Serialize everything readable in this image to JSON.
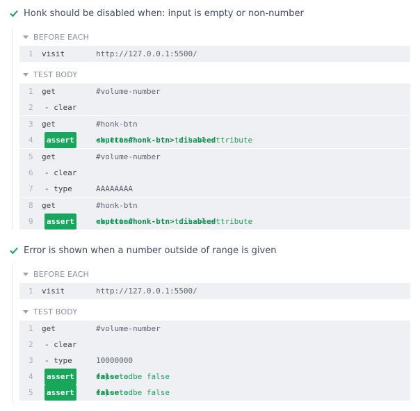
{
  "colors": {
    "pass": "#13a15a",
    "badge": "#16a75b",
    "row_bg": "#eff0f3"
  },
  "icons": {
    "check": "check-icon",
    "caret": "caret-down-icon"
  },
  "tests": [
    {
      "title": "Honk should be disabled when: input is empty or non-number",
      "before_each_label": "BEFORE EACH",
      "before_each": [
        {
          "num": "1",
          "name": "visit",
          "msg": "http://127.0.0.1:5500/"
        }
      ],
      "test_body_label": "TEST BODY",
      "body": [
        {
          "num": "1",
          "name": "get",
          "msg": "#volume-number"
        },
        {
          "num": "2",
          "name": "- clear",
          "msg": ""
        },
        {
          "num": "3",
          "name": "get",
          "msg": "#honk-btn"
        },
        {
          "num": "4",
          "name": "assert",
          "dash": "-",
          "pre": "expected ",
          "b1": "<button#honk-btn>",
          "mid": " to have attribute ",
          "b2": "disabled"
        },
        {
          "num": "5",
          "name": "get",
          "msg": "#volume-number"
        },
        {
          "num": "6",
          "name": "- clear",
          "msg": ""
        },
        {
          "num": "7",
          "name": "- type",
          "msg": "AAAAAAAA"
        },
        {
          "num": "8",
          "name": "get",
          "msg": "#honk-btn"
        },
        {
          "num": "9",
          "name": "assert",
          "dash": "-",
          "pre": "expected ",
          "b1": "<button#honk-btn>",
          "mid": " to have attribute ",
          "b2": "disabled"
        }
      ]
    },
    {
      "title": "Error is shown when a number outside of range is given",
      "before_each_label": "BEFORE EACH",
      "before_each": [
        {
          "num": "1",
          "name": "visit",
          "msg": "http://127.0.0.1:5500/"
        }
      ],
      "test_body_label": "TEST BODY",
      "body": [
        {
          "num": "1",
          "name": "get",
          "msg": "#volume-number"
        },
        {
          "num": "2",
          "name": "- clear",
          "msg": ""
        },
        {
          "num": "3",
          "name": "- type",
          "msg": "10000000"
        },
        {
          "num": "4",
          "name": "assert",
          "dash": "-",
          "pre": "expected ",
          "b1": "false",
          "mid": " to be false",
          "b2": ""
        },
        {
          "num": "5",
          "name": "assert",
          "dash": "-",
          "pre": "expected ",
          "b1": "false",
          "mid": " to be false",
          "b2": ""
        }
      ]
    }
  ]
}
